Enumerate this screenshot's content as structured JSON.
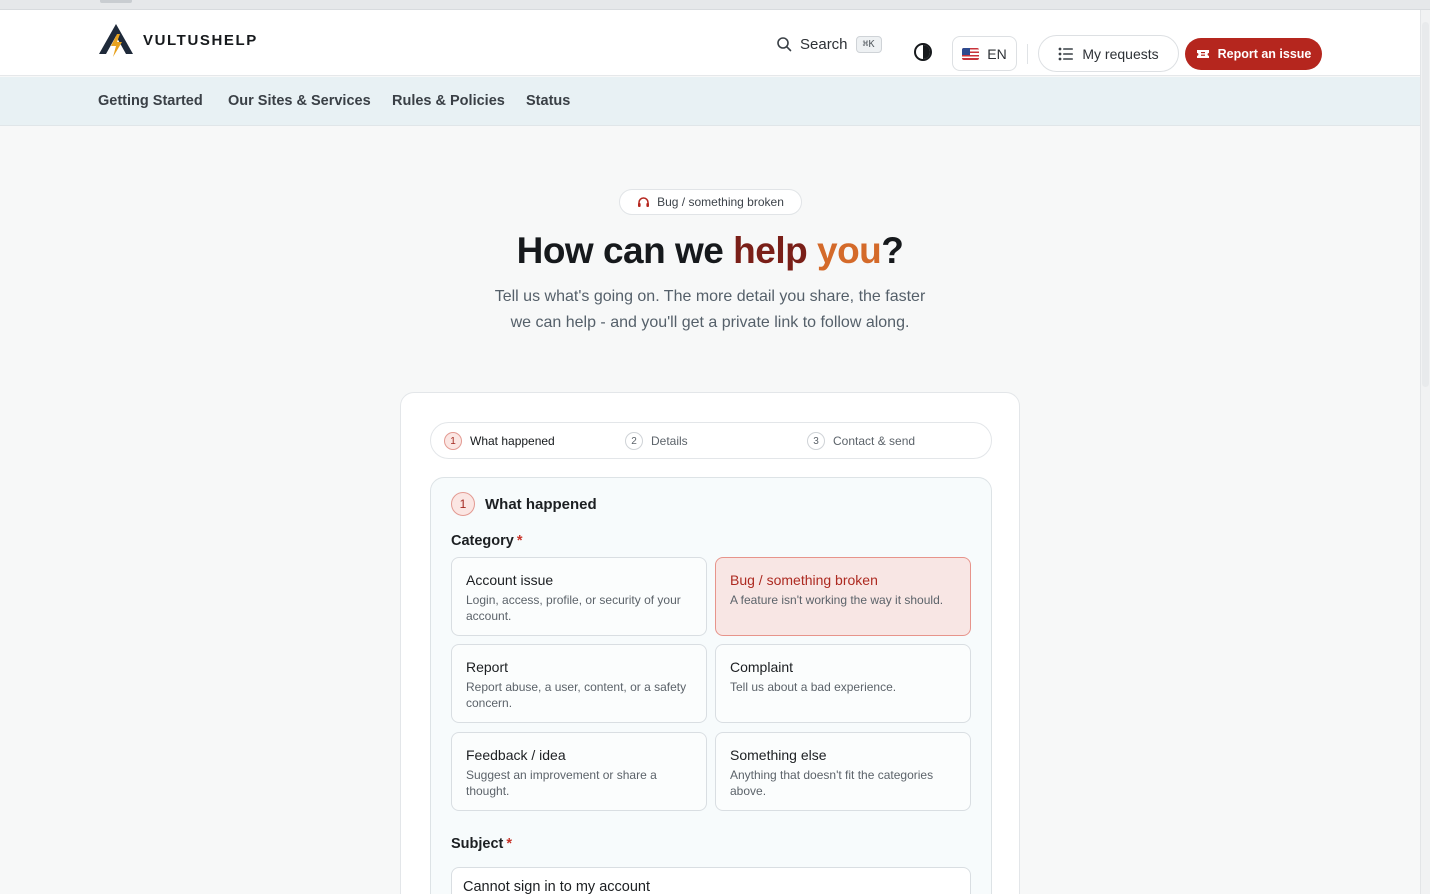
{
  "brand": {
    "name": "VULTUSHELP"
  },
  "header": {
    "search_label": "Search",
    "search_shortcut": "⌘K",
    "language": "EN",
    "my_requests": "My requests",
    "report_issue": "Report an issue"
  },
  "nav": {
    "items": [
      {
        "label": "Getting Started"
      },
      {
        "label": "Our Sites & Services"
      },
      {
        "label": "Rules & Policies"
      },
      {
        "label": "Status"
      }
    ]
  },
  "hero": {
    "badge": "Bug / something broken",
    "title_part1": "How can we ",
    "title_part2": "help",
    "title_part3": " ",
    "title_part4": "you",
    "title_part5": "?",
    "subtitle": "Tell us what's going on. The more detail you share, the faster we can help - and you'll get a private link to follow along."
  },
  "stepper": {
    "steps": [
      {
        "num": "1",
        "label": "What happened"
      },
      {
        "num": "2",
        "label": "Details"
      },
      {
        "num": "3",
        "label": "Contact & send"
      }
    ]
  },
  "panel": {
    "num": "1",
    "title": "What happened",
    "category_label": "Category",
    "required_mark": "*",
    "categories": [
      {
        "title": "Account issue",
        "desc": "Login, access, profile, or security of your account."
      },
      {
        "title": "Bug / something broken",
        "desc": "A feature isn't working the way it should."
      },
      {
        "title": "Report",
        "desc": "Report abuse, a user, content, or a safety concern."
      },
      {
        "title": "Complaint",
        "desc": "Tell us about a bad experience."
      },
      {
        "title": "Feedback / idea",
        "desc": "Suggest an improvement or share a thought."
      },
      {
        "title": "Something else",
        "desc": "Anything that doesn't fit the categories above."
      }
    ],
    "selected_category": "Bug / something broken",
    "subject_label": "Subject",
    "subject_value": "Cannot sign in to my account"
  },
  "colors": {
    "accent_red": "#b5261e",
    "subnav_bg": "#e8f1f4",
    "selected_bg": "#f8e6e4"
  },
  "icons": {
    "logo": "bolt-mountain-logo-icon",
    "search": "search-icon",
    "theme": "contrast-toggle-icon",
    "flag": "us-flag-icon",
    "requests": "list-icon",
    "report": "ticket-icon",
    "badge": "headset-icon"
  }
}
